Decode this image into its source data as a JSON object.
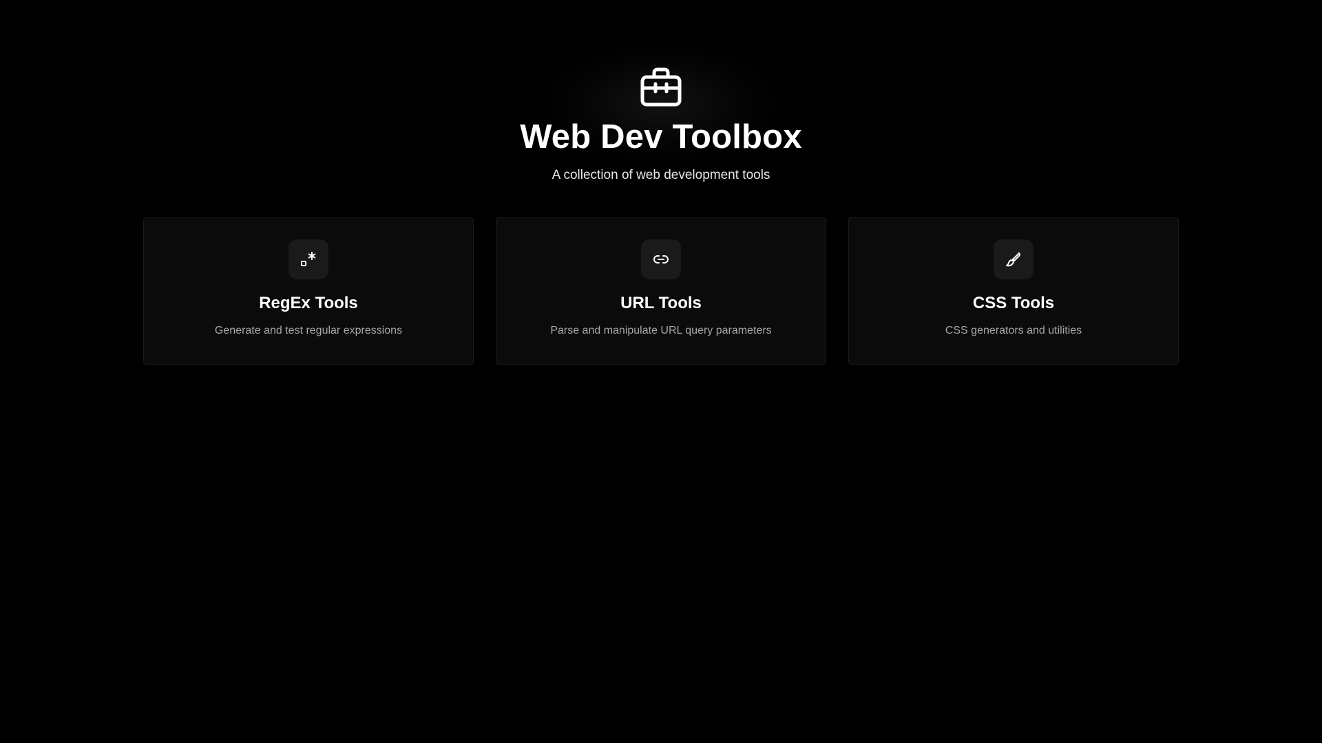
{
  "header": {
    "icon": "toolbox-icon",
    "title": "Web Dev Toolbox",
    "subtitle": "A collection of web development tools"
  },
  "tools": [
    {
      "icon": "regex-icon",
      "title": "RegEx Tools",
      "description": "Generate and test regular expressions"
    },
    {
      "icon": "link-icon",
      "title": "URL Tools",
      "description": "Parse and manipulate URL query parameters"
    },
    {
      "icon": "paintbrush-icon",
      "title": "CSS Tools",
      "description": "CSS generators and utilities"
    }
  ],
  "colors": {
    "background": "#000000",
    "card_background": "#0b0b0b",
    "card_border": "#1c1c1c",
    "icon_box": "#1a1a1a",
    "text_primary": "#ffffff",
    "text_secondary": "#a8a8a8"
  }
}
